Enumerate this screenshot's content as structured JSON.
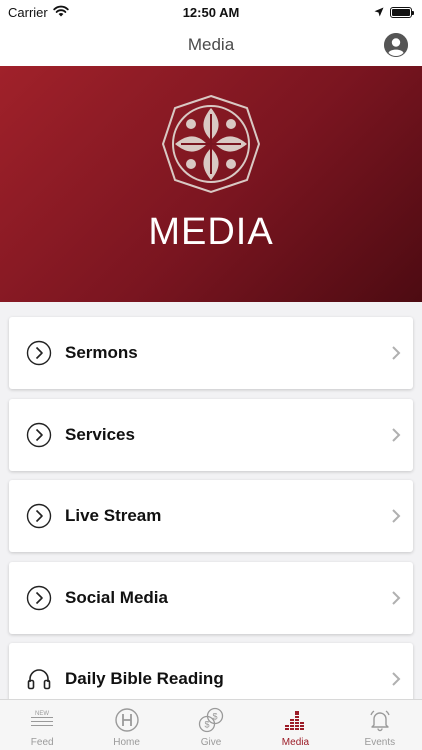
{
  "status_bar": {
    "carrier": "Carrier",
    "time": "12:50 AM"
  },
  "nav": {
    "title": "Media"
  },
  "hero": {
    "title": "MEDIA"
  },
  "list": {
    "items": [
      {
        "label": "Sermons",
        "icon": "play-circle-icon"
      },
      {
        "label": "Services",
        "icon": "play-circle-icon"
      },
      {
        "label": "Live Stream",
        "icon": "play-circle-icon"
      },
      {
        "label": "Social Media",
        "icon": "play-circle-icon"
      },
      {
        "label": "Daily Bible Reading",
        "icon": "headphones-icon"
      }
    ]
  },
  "tab_bar": {
    "tabs": [
      {
        "label": "Feed",
        "icon": "newspaper-icon",
        "active": false
      },
      {
        "label": "Home",
        "icon": "home-badge-icon",
        "active": false
      },
      {
        "label": "Give",
        "icon": "coins-icon",
        "active": false
      },
      {
        "label": "Media",
        "icon": "equalizer-icon",
        "active": true
      },
      {
        "label": "Events",
        "icon": "bell-icon",
        "active": false
      }
    ],
    "new_badge": "NEW"
  },
  "colors": {
    "accent": "#9b1b26",
    "hero_gradient_start": "#a0212a",
    "hero_gradient_end": "#4d0b12",
    "inactive_tab": "#9a9a9a"
  }
}
